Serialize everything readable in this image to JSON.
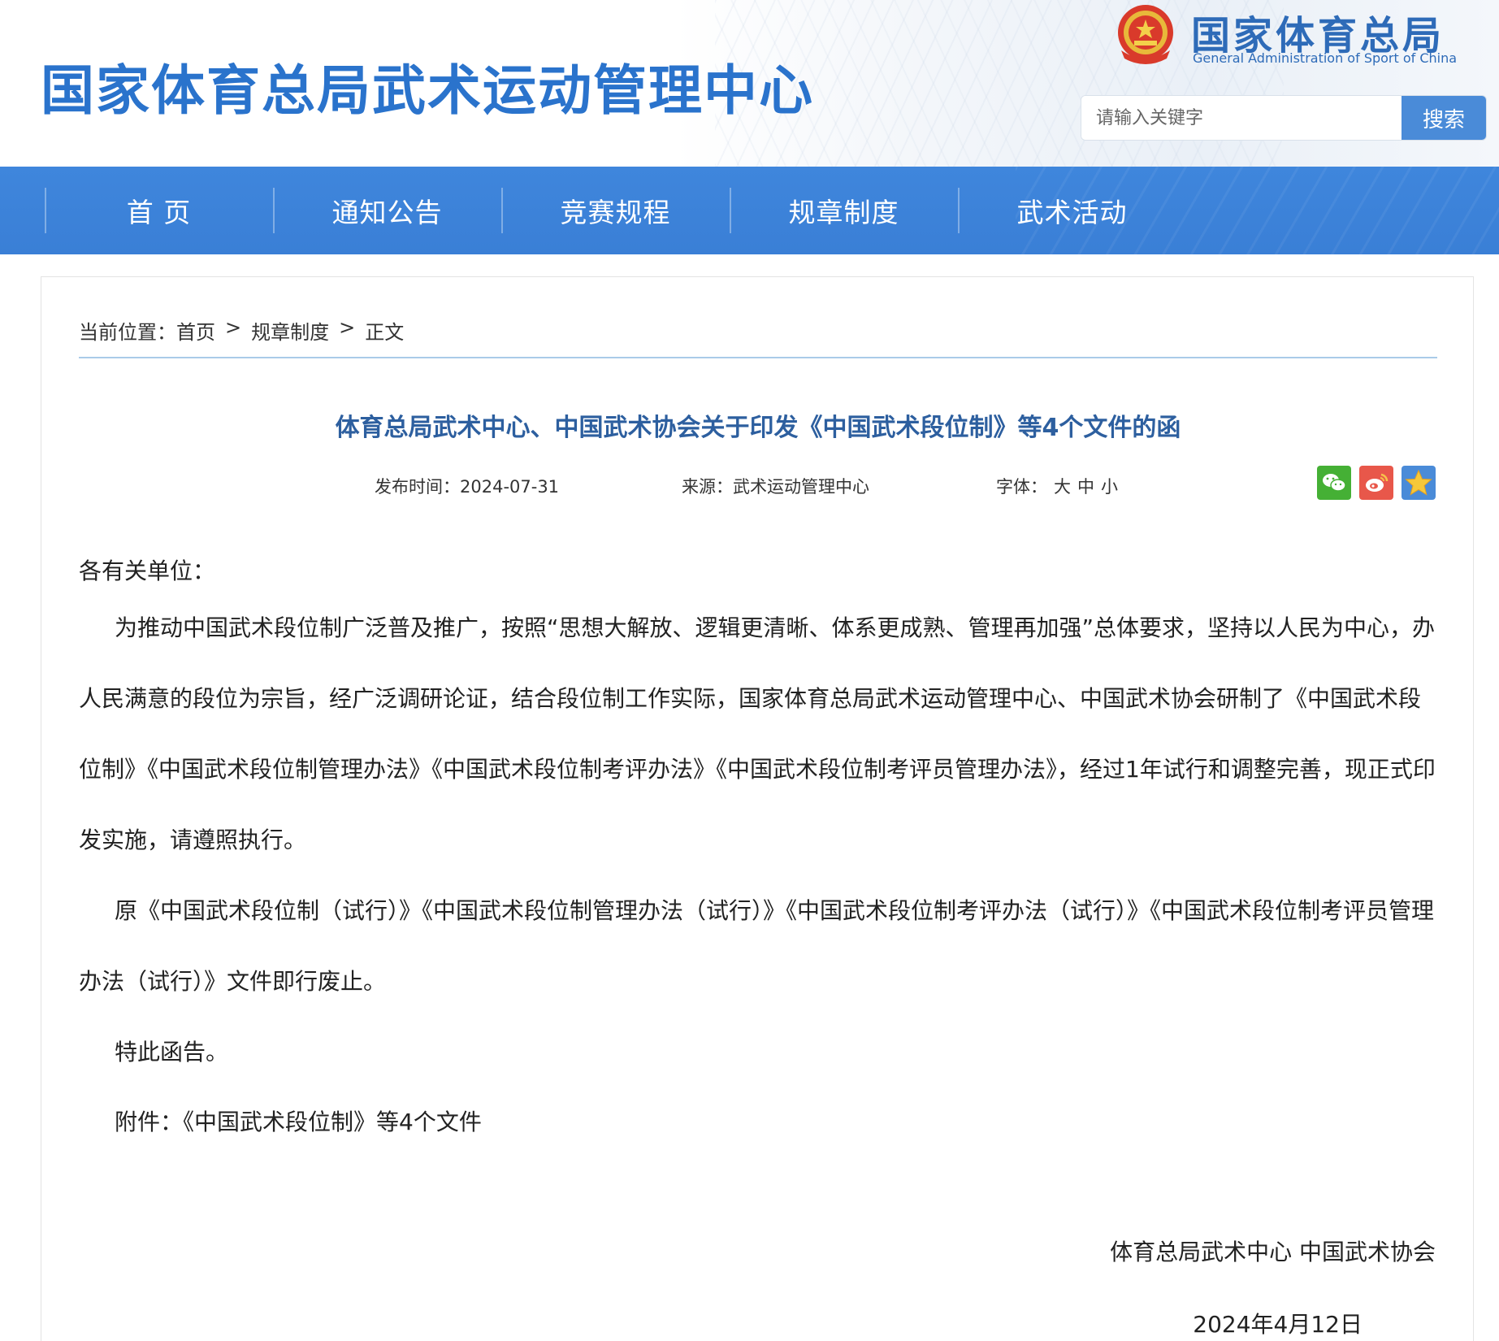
{
  "header": {
    "site_title": "国家体育总局武术运动管理中心",
    "gov_name": "国家体育总局",
    "gov_name_en": "General Administration of Sport of China",
    "search_placeholder": "请输入关键字",
    "search_button": "搜索"
  },
  "nav": {
    "items": [
      "首 页",
      "通知公告",
      "竞赛规程",
      "规章制度",
      "武术活动"
    ]
  },
  "breadcrumb": {
    "prefix": "当前位置：",
    "items": [
      "首页",
      "规章制度",
      "正文"
    ],
    "separator": ">"
  },
  "article": {
    "title": "体育总局武术中心、中国武术协会关于印发《中国武术段位制》等4个文件的函",
    "publish_time": "发布时间：2024-07-31",
    "source": "来源：武术运动管理中心",
    "font_label": "字体：",
    "font_sizes": [
      "大",
      "中",
      "小"
    ],
    "salutation": "各有关单位：",
    "paragraphs": [
      "为推动中国武术段位制广泛普及推广，按照“思想大解放、逻辑更清晰、体系更成熟、管理再加强”总体要求，坚持以人民为中心，办人民满意的段位为宗旨，经广泛调研论证，结合段位制工作实际，国家体育总局武术运动管理中心、中国武术协会研制了《中国武术段位制》《中国武术段位制管理办法》《中国武术段位制考评办法》《中国武术段位制考评员管理办法》，经过1年试行和调整完善，现正式印发实施，请遵照执行。",
      "原《中国武术段位制（试行）》《中国武术段位制管理办法（试行）》《中国武术段位制考评办法（试行）》《中国武术段位制考评员管理办法（试行）》文件即行废止。",
      "特此函告。",
      "附件：《中国武术段位制》等4个文件"
    ],
    "signature_org": "体育总局武术中心 中国武术协会",
    "signature_date": "2024年4月12日"
  },
  "share": {
    "icons": [
      "wechat-icon",
      "weibo-icon",
      "favorite-star-icon"
    ]
  },
  "colors": {
    "title_blue": "#2a73cc",
    "nav_blue": "#3f86dc",
    "article_title": "#2d5f9f",
    "search_button": "#4a8bd8"
  }
}
